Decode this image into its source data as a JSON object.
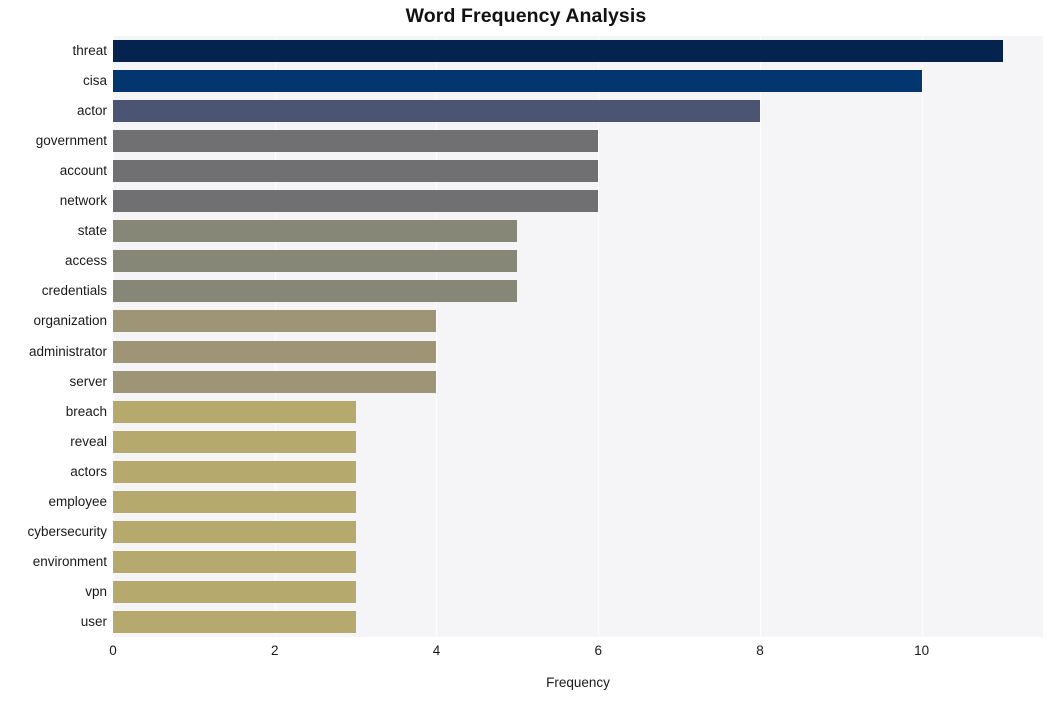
{
  "chart_data": {
    "type": "bar",
    "orientation": "horizontal",
    "title": "Word Frequency Analysis",
    "xlabel": "Frequency",
    "ylabel": "",
    "categories": [
      "threat",
      "cisa",
      "actor",
      "government",
      "account",
      "network",
      "state",
      "access",
      "credentials",
      "organization",
      "administrator",
      "server",
      "breach",
      "reveal",
      "actors",
      "employee",
      "cybersecurity",
      "environment",
      "vpn",
      "user"
    ],
    "values": [
      11,
      10,
      8,
      6,
      6,
      6,
      5,
      5,
      5,
      4,
      4,
      4,
      3,
      3,
      3,
      3,
      3,
      3,
      3,
      3
    ],
    "bar_colors": [
      "#04244f",
      "#03356f",
      "#4b5472",
      "#707073",
      "#707073",
      "#707073",
      "#878778",
      "#878778",
      "#878778",
      "#9d9576",
      "#9d9576",
      "#9d9576",
      "#b5a96e",
      "#b5a96e",
      "#b5a96e",
      "#b5a96e",
      "#b5a96e",
      "#b5a96e",
      "#b5a96e",
      "#b5a96e"
    ],
    "xticks": [
      0,
      2,
      4,
      6,
      8,
      10
    ],
    "xtick_labels": [
      "0",
      "2",
      "4",
      "6",
      "8",
      "10"
    ],
    "xlim": [
      0,
      11.5
    ],
    "grid": true,
    "grid_axis": "x",
    "legend": null,
    "plot_background": "#f5f5f7",
    "figure_background": "#ffffff"
  }
}
